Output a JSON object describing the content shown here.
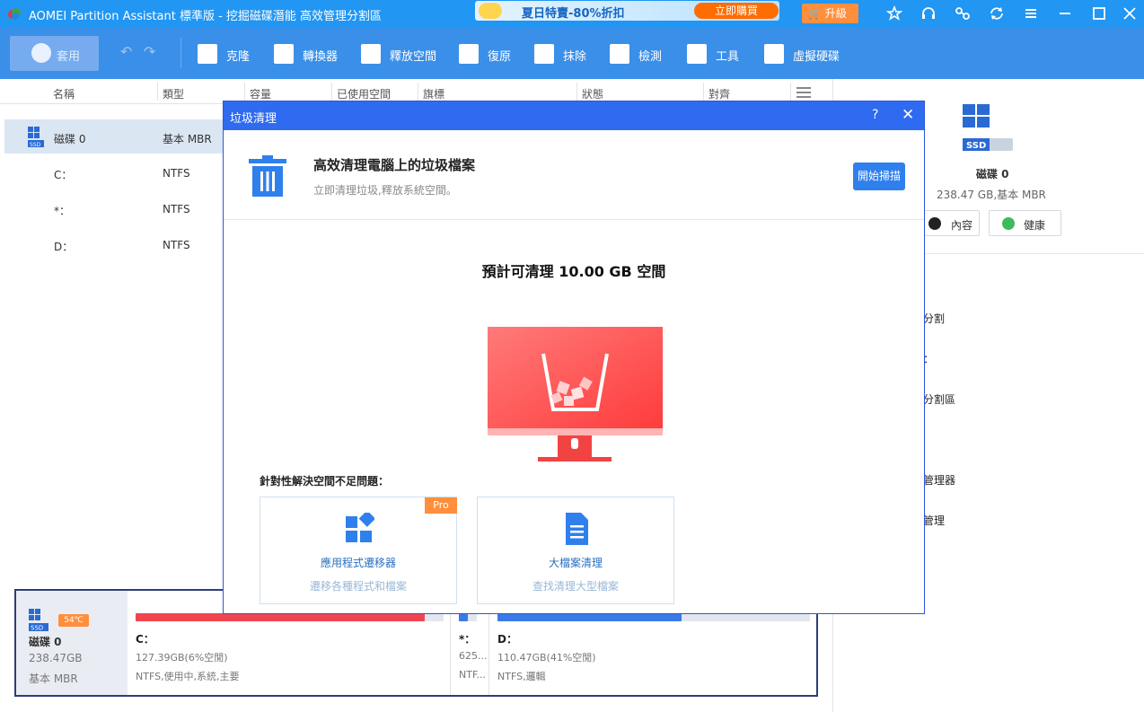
{
  "titlebar": {
    "title": "AOMEI Partition Assistant 標準版 - 挖掘磁碟潛能 高效管理分割區",
    "promo_text": "夏日特賣-80%折扣",
    "promo_button": "立即購買",
    "upgrade_button": "升級",
    "icons": [
      "star-icon",
      "headset-icon",
      "link-icon",
      "refresh-icon",
      "menu-icon",
      "minimize-icon",
      "maximize-icon",
      "close-icon"
    ]
  },
  "toolbar": {
    "apply": "套用",
    "tools": [
      {
        "label": "克隆",
        "icon": "clone-icon"
      },
      {
        "label": "轉換器",
        "icon": "convert-icon"
      },
      {
        "label": "釋放空間",
        "icon": "free-space-icon"
      },
      {
        "label": "復原",
        "icon": "recover-icon"
      },
      {
        "label": "抹除",
        "icon": "wipe-icon"
      },
      {
        "label": "檢測",
        "icon": "test-icon"
      },
      {
        "label": "工具",
        "icon": "tools-icon"
      },
      {
        "label": "虛擬硬碟",
        "icon": "virtual-disk-icon"
      }
    ]
  },
  "columns": [
    "名稱",
    "類型",
    "容量",
    "已使用空間",
    "旗標",
    "狀態",
    "對齊"
  ],
  "disk_list": [
    {
      "name": "磁碟 0",
      "type": "基本 MBR"
    },
    {
      "name": "C：",
      "type": "NTFS"
    },
    {
      "name": "*：",
      "type": "NTFS"
    },
    {
      "name": "D：",
      "type": "NTFS"
    }
  ],
  "right_panel": {
    "disk_name": "磁碟 0",
    "disk_info": "238.47 GB,基本 MBR",
    "properties_button": "內容",
    "health_button": "健康",
    "operations": [
      "分割",
      "：",
      "分割區",
      "管理器",
      "管理"
    ]
  },
  "disk_map": {
    "name": "磁碟 0",
    "size": "238.47GB",
    "type": "基本 MBR",
    "temperature": "54℃",
    "partitions": [
      {
        "label": "C：",
        "capacity": "127.39GB(6%空閒)",
        "info": "NTFS,使用中,系統,主要",
        "used_fraction": 0.94,
        "color": "#f0454f"
      },
      {
        "label": "*：",
        "capacity": "625...",
        "info": "NTF...",
        "used_fraction": 0.5,
        "color": "#3a7be8"
      },
      {
        "label": "D：",
        "capacity": "110.47GB(41%空閒)",
        "info": "NTFS,邏輯",
        "used_fraction": 0.59,
        "color": "#3a7be8"
      }
    ]
  },
  "dialog": {
    "title": "垃圾清理",
    "help": "?",
    "close": "✕",
    "heading": "高效清理電腦上的垃圾檔案",
    "subheading": "立即清理垃圾,釋放系統空間。",
    "scan_button": "開始掃描",
    "estimate": "預計可清理 10.00 GB 空間",
    "solve_title": "針對性解決空間不足問題：",
    "cards": [
      {
        "title": "應用程式遷移器",
        "desc": "遷移各種程式和檔案",
        "badge": "Pro",
        "icon": "app-mover-icon"
      },
      {
        "title": "大檔案清理",
        "desc": "查找清理大型檔案",
        "icon": "large-file-icon"
      }
    ]
  },
  "colors": {
    "accent": "#2196f3",
    "toolbar": "#3a8fe8",
    "dialog_bar": "#2f6bf0",
    "alert_red": "#f0454f",
    "orange": "#ff8f3c"
  }
}
